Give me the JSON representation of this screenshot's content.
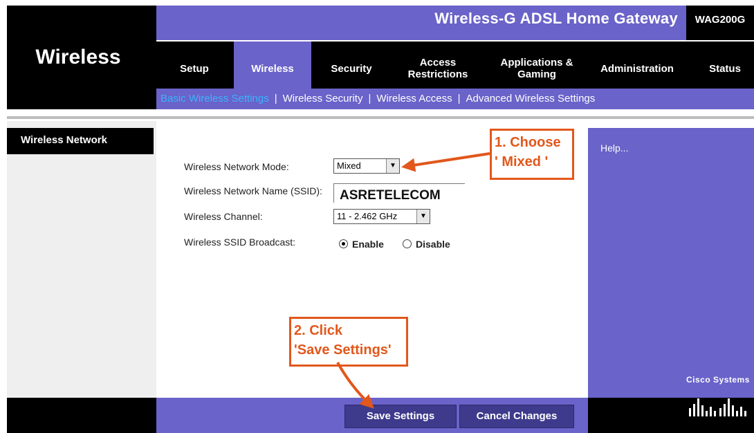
{
  "header": {
    "section_title": "Wireless",
    "product_title": "Wireless-G ADSL Home Gateway",
    "model_code": "WAG200G"
  },
  "tabs": [
    {
      "label": "Setup",
      "active": false
    },
    {
      "label": "Wireless",
      "active": true
    },
    {
      "label": "Security",
      "active": false
    },
    {
      "label": "Access Restrictions",
      "active": false
    },
    {
      "label": "Applications & Gaming",
      "active": false
    },
    {
      "label": "Administration",
      "active": false
    },
    {
      "label": "Status",
      "active": false
    }
  ],
  "subnav": [
    {
      "label": "Basic Wireless Settings",
      "active": true
    },
    {
      "label": "Wireless Security",
      "active": false
    },
    {
      "label": "Wireless Access",
      "active": false
    },
    {
      "label": "Advanced Wireless Settings",
      "active": false
    }
  ],
  "sidebar": {
    "label": "Wireless Network"
  },
  "form": {
    "mode_label": "Wireless Network Mode:",
    "mode_value": "Mixed",
    "ssid_label": "Wireless Network Name (SSID):",
    "ssid_value": "ASRETELECOM",
    "channel_label": "Wireless Channel:",
    "channel_value": "11 - 2.462 GHz",
    "broadcast_label": "Wireless SSID Broadcast:",
    "broadcast_enable": "Enable",
    "broadcast_disable": "Disable",
    "broadcast_selected": "Enable"
  },
  "help": {
    "text": "Help..."
  },
  "buttons": {
    "save": "Save Settings",
    "cancel": "Cancel Changes"
  },
  "brand": {
    "name": "Cisco Systems"
  },
  "annotations": {
    "step1_line1": "1. Choose",
    "step1_line2": "' Mixed '",
    "step2_line1": "2. Click",
    "step2_line2": "'Save Settings'"
  },
  "colors": {
    "purple": "#6a63c9",
    "black": "#000000",
    "active_subnav": "#3bb3ff",
    "annotation": "#e2571b"
  }
}
